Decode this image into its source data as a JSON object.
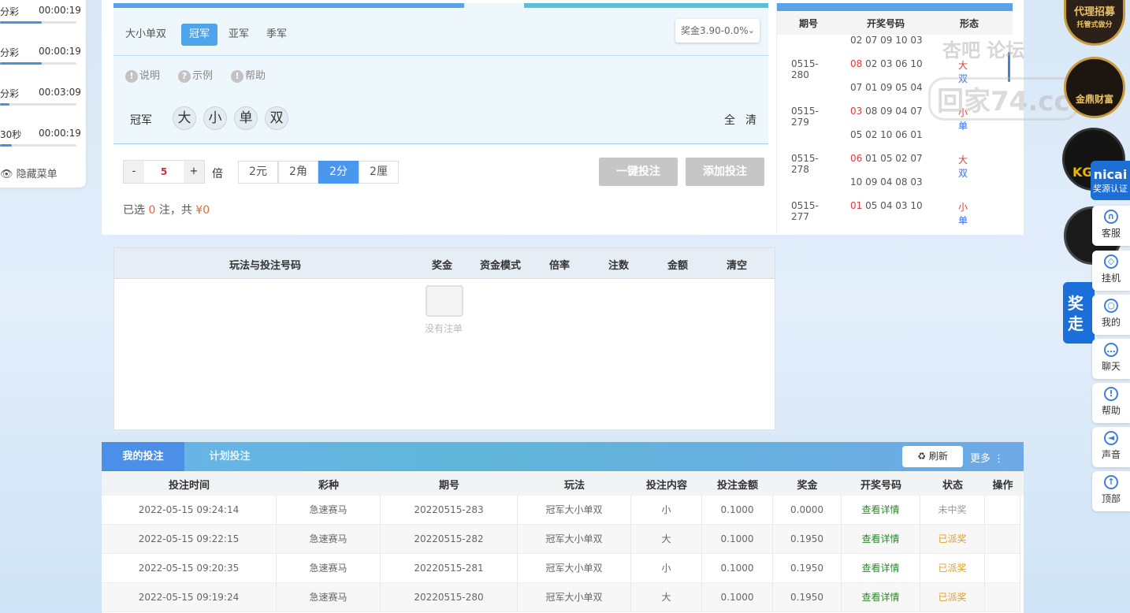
{
  "left_panel": {
    "rows": [
      {
        "name": "分彩",
        "time": "00:00:19",
        "progress": 0.55
      },
      {
        "name": "分彩",
        "time": "00:00:19",
        "progress": 0.55
      },
      {
        "name": "分彩",
        "time": "00:03:09",
        "progress": 0.12
      },
      {
        "name": "30秒",
        "time": "00:00:19",
        "progress": 0.15
      }
    ],
    "hide_menu": "隐藏菜单"
  },
  "bet": {
    "play_name": "大小单双",
    "sub_tabs": [
      "冠军",
      "亚军",
      "季军"
    ],
    "odds": "奖金3.90-0.0%",
    "info_links": [
      "说明",
      "示例",
      "帮助"
    ],
    "row_label": "冠军",
    "balls": [
      "大",
      "小",
      "单",
      "双"
    ],
    "quick": [
      "全",
      "清"
    ],
    "multiplier": "5",
    "bei": "倍",
    "units": [
      "2元",
      "2角",
      "2分",
      "2厘"
    ],
    "one_key_btn": "一键投注",
    "add_btn": "添加投注",
    "summary_pre": "已选",
    "summary_count": "0",
    "summary_mid": "注，共",
    "summary_amount": "¥0"
  },
  "history": {
    "headers": [
      "期号",
      "开奖号码",
      "形态"
    ],
    "rows": [
      {
        "period": "",
        "first": "",
        "nums": "02 07 09 10 03",
        "big": "",
        "parity": ""
      },
      {
        "period": "0515-280",
        "first": "08",
        "nums": " 02 03 06 10",
        "big": "大",
        "parity": "双"
      },
      {
        "period": "",
        "first": "",
        "nums": "07 01 09 05 04",
        "big": "",
        "parity": ""
      },
      {
        "period": "0515-279",
        "first": "03",
        "nums": " 08 09 04 07",
        "big": "小",
        "parity": "单"
      },
      {
        "period": "",
        "first": "",
        "nums": "05 02 10 06 01",
        "big": "",
        "parity": ""
      },
      {
        "period": "0515-278",
        "first": "06",
        "nums": " 01 05 02 07",
        "big": "大",
        "parity": "双"
      },
      {
        "period": "",
        "first": "",
        "nums": "10 09 04 08 03",
        "big": "",
        "parity": ""
      },
      {
        "period": "0515-277",
        "first": "01",
        "nums": " 05 04 03 10",
        "big": "小",
        "parity": "单"
      }
    ]
  },
  "watermark": {
    "line1": "杏吧 论坛",
    "line2": "回家74.cc"
  },
  "bet_list": {
    "headers": [
      "玩法与投注号码",
      "奖金",
      "资金模式",
      "倍率",
      "注数",
      "金额",
      "清空"
    ],
    "empty": "没有注单"
  },
  "my_bets": {
    "tabs": [
      "我的投注",
      "计划投注"
    ],
    "refresh": "♻ 刷新",
    "more": "更多 ⋮",
    "headers": [
      "投注时间",
      "彩种",
      "期号",
      "玩法",
      "投注内容",
      "投注金额",
      "奖金",
      "开奖号码",
      "状态",
      "操作"
    ],
    "rows": [
      {
        "time": "2022-05-15 09:24:14",
        "game": "急速赛马",
        "period": "20220515-283",
        "play": "冠军大小单双",
        "content": "小",
        "amount": "0.1000",
        "bonus": "0.0000",
        "draw": "查看详情",
        "status": "未中奖",
        "win": false
      },
      {
        "time": "2022-05-15 09:22:15",
        "game": "急速赛马",
        "period": "20220515-282",
        "play": "冠军大小单双",
        "content": "大",
        "amount": "0.1000",
        "bonus": "0.1950",
        "draw": "查看详情",
        "status": "已派奖",
        "win": true
      },
      {
        "time": "2022-05-15 09:20:35",
        "game": "急速赛马",
        "period": "20220515-281",
        "play": "冠军大小单双",
        "content": "小",
        "amount": "0.1000",
        "bonus": "0.1950",
        "draw": "查看详情",
        "status": "已派奖",
        "win": true
      },
      {
        "time": "2022-05-15 09:19:24",
        "game": "急速赛马",
        "period": "20220515-280",
        "play": "冠军大小单双",
        "content": "大",
        "amount": "0.1000",
        "bonus": "0.1950",
        "draw": "查看详情",
        "status": "已派奖",
        "win": true
      }
    ]
  },
  "side_tools": {
    "nicai": "nicai",
    "nicai_sub": "奖源认证",
    "promo": "奖走",
    "items": [
      {
        "label": "客服",
        "icon": "headset-icon"
      },
      {
        "label": "挂机",
        "icon": "diamond-icon"
      },
      {
        "label": "我的",
        "icon": "user-icon"
      },
      {
        "label": "聊天",
        "icon": "chat-icon"
      },
      {
        "label": "帮助",
        "icon": "help-icon"
      },
      {
        "label": "声音",
        "icon": "speaker-icon"
      },
      {
        "label": "顶部",
        "icon": "arrow-up-icon"
      }
    ]
  },
  "logos": {
    "top": "代理招募",
    "top_sub": "托管式做分",
    "mid": "金鼎财富",
    "kg": "KG"
  }
}
